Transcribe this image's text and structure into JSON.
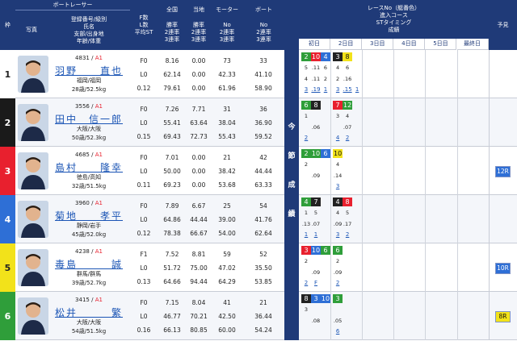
{
  "header": {
    "waku": "枠",
    "boat_racer": "ボートレーサー",
    "photo": "写真",
    "info_lines": [
      "登録番号/級別",
      "氏名",
      "支部/出身地",
      "年齢/体重"
    ],
    "f_lines": [
      "F数",
      "L数",
      "平均ST"
    ],
    "zenkoku": "全国",
    "touchi": "当地",
    "motor": "モーター",
    "boat": "ボート",
    "rate_lines": [
      "勝率",
      "2連率",
      "3連率"
    ],
    "no_lines": [
      "No",
      "2連率",
      "3連率"
    ],
    "race_lines": [
      "レースNo（艇番色）",
      "進入コース",
      "STタイミング",
      "成績"
    ],
    "days": [
      "初日",
      "2日目",
      "3日目",
      "4日目",
      "5日目",
      "最終日"
    ],
    "yosou": "予見",
    "konsetsu": [
      "今",
      "節",
      "成",
      "績"
    ]
  },
  "racers": [
    {
      "waku": "1",
      "reg": "4831",
      "cls": "A1",
      "name": "羽野　　直也",
      "region": "福岡/福岡",
      "agewt": "28歳/52.5kg",
      "f": [
        "F0",
        "L0",
        "0.12"
      ],
      "nat": [
        "8.16",
        "62.14",
        "79.61"
      ],
      "loc": [
        "0.00",
        "0.00",
        "0.00"
      ],
      "motor": [
        "73",
        "42.33",
        "61.96"
      ],
      "boat": [
        "33",
        "41.10",
        "58.90"
      ],
      "sessions": [
        {
          "c": [
            "2",
            "10",
            "4"
          ],
          "colors": [
            "#2f9e3a",
            "#e8202e",
            "#2e6fd6"
          ],
          "course": [
            "5",
            ".11",
            "6"
          ],
          "st": [
            "4",
            ".11",
            "2"
          ],
          "res": [
            "3",
            ".19",
            "1"
          ]
        },
        {
          "c": [
            "3",
            "8"
          ],
          "colors": [
            "#222",
            "#f2e21a"
          ],
          "course": [
            "4",
            "6"
          ],
          "st": [
            "2",
            ".16"
          ],
          "res": [
            "3",
            ".15",
            "1"
          ]
        }
      ],
      "prev": ""
    },
    {
      "waku": "2",
      "reg": "3556",
      "cls": "A1",
      "name": "田中　信一郎",
      "region": "大阪/大阪",
      "agewt": "50歳/52.3kg",
      "f": [
        "F0",
        "L0",
        "0.15"
      ],
      "nat": [
        "7.26",
        "55.41",
        "69.43"
      ],
      "loc": [
        "7.71",
        "63.64",
        "72.73"
      ],
      "motor": [
        "31",
        "38.04",
        "55.43"
      ],
      "boat": [
        "36",
        "36.90",
        "59.52"
      ],
      "sessions": [
        {
          "c": [
            "6",
            "8"
          ],
          "colors": [
            "#2f9e3a",
            "#222"
          ],
          "course": [
            "1",
            "",
            ""
          ],
          "st": [
            "",
            ".06",
            ""
          ],
          "res": [
            "2",
            "",
            ""
          ]
        },
        {
          "c": [
            "7",
            "12"
          ],
          "colors": [
            "#e8202e",
            "#2f9e3a"
          ],
          "course": [
            "3",
            "4"
          ],
          "st": [
            "",
            ".07"
          ],
          "res": [
            "4",
            "2"
          ]
        }
      ],
      "prev": ""
    },
    {
      "waku": "3",
      "reg": "4685",
      "cls": "A1",
      "name": "島村　　隆幸",
      "region": "徳島/高知",
      "agewt": "32歳/51.5kg",
      "f": [
        "F0",
        "L0",
        "0.11"
      ],
      "nat": [
        "7.01",
        "50.00",
        "69.23"
      ],
      "loc": [
        "0.00",
        "0.00",
        "0.00"
      ],
      "motor": [
        "21",
        "38.42",
        "53.68"
      ],
      "boat": [
        "42",
        "44.44",
        "63.33"
      ],
      "sessions": [
        {
          "c": [
            "2",
            "10",
            "6"
          ],
          "colors": [
            "#2f9e3a",
            "#2f9e3a",
            "#2e6fd6"
          ],
          "course": [
            "2",
            "",
            ""
          ],
          "st": [
            "",
            ".09",
            ""
          ],
          "res": [
            "",
            "",
            ""
          ]
        },
        {
          "c": [
            "10"
          ],
          "colors": [
            "#f2e21a"
          ],
          "course": [
            "4"
          ],
          "st": [
            ".14"
          ],
          "res": [
            "3"
          ]
        }
      ],
      "prev": "12R"
    },
    {
      "waku": "4",
      "reg": "3960",
      "cls": "A1",
      "name": "菊地　　孝平",
      "region": "静岡/岩手",
      "agewt": "45歳/52.0kg",
      "f": [
        "F0",
        "L0",
        "0.12"
      ],
      "nat": [
        "7.89",
        "64.86",
        "78.38"
      ],
      "loc": [
        "6.67",
        "44.44",
        "66.67"
      ],
      "motor": [
        "25",
        "39.00",
        "54.00"
      ],
      "boat": [
        "54",
        "41.76",
        "62.64"
      ],
      "sessions": [
        {
          "c": [
            "4",
            "7"
          ],
          "colors": [
            "#2f9e3a",
            "#222"
          ],
          "course": [
            "1",
            "5"
          ],
          "st": [
            ".13",
            ".07"
          ],
          "res": [
            "1",
            "1"
          ]
        },
        {
          "c": [
            "4",
            "8"
          ],
          "colors": [
            "#222",
            "#e8202e"
          ],
          "course": [
            "4",
            "5"
          ],
          "st": [
            ".09",
            ".17"
          ],
          "res": [
            "3",
            "2"
          ]
        }
      ],
      "prev": ""
    },
    {
      "waku": "5",
      "reg": "4238",
      "cls": "A1",
      "name": "毒島　　　誠",
      "region": "群馬/群馬",
      "agewt": "39歳/52.7kg",
      "f": [
        "F1",
        "L0",
        "0.13"
      ],
      "nat": [
        "7.52",
        "51.72",
        "64.66"
      ],
      "loc": [
        "8.81",
        "75.00",
        "94.44"
      ],
      "motor": [
        "59",
        "47.02",
        "64.29"
      ],
      "boat": [
        "52",
        "35.50",
        "53.85"
      ],
      "sessions": [
        {
          "c": [
            "3",
            "10",
            "6"
          ],
          "colors": [
            "#e8202e",
            "#2e6fd6",
            "#2f9e3a"
          ],
          "course": [
            "2",
            "",
            ""
          ],
          "st": [
            "",
            ".09",
            ""
          ],
          "res": [
            "2",
            "F",
            ""
          ]
        },
        {
          "c": [
            "6"
          ],
          "colors": [
            "#2f9e3a"
          ],
          "course": [
            "2"
          ],
          "st": [
            ".09"
          ],
          "res": [
            "2"
          ]
        }
      ],
      "prev": "10R"
    },
    {
      "waku": "6",
      "reg": "3415",
      "cls": "A1",
      "name": "松井　　　繁",
      "region": "大阪/大阪",
      "agewt": "54歳/51.5kg",
      "f": [
        "F0",
        "L0",
        "0.16"
      ],
      "nat": [
        "7.15",
        "46.77",
        "66.13"
      ],
      "loc": [
        "8.04",
        "70.21",
        "80.85"
      ],
      "motor": [
        "41",
        "42.50",
        "60.00"
      ],
      "boat": [
        "21",
        "36.44",
        "54.24"
      ],
      "sessions": [
        {
          "c": [
            "8",
            "3",
            "10"
          ],
          "colors": [
            "#222",
            "#2e6fd6",
            "#2e6fd6"
          ],
          "course": [
            "3",
            "",
            ""
          ],
          "st": [
            "",
            ".08",
            ""
          ],
          "res": [
            "",
            "",
            ""
          ]
        },
        {
          "c": [
            "3"
          ],
          "colors": [
            "#2f9e3a"
          ],
          "course": [
            "",
            ""
          ],
          "st": [
            ".05"
          ],
          "res": [
            "6"
          ]
        }
      ],
      "prev": "8R"
    }
  ],
  "colors": {
    "header": "#1f3a78",
    "highlight": "#e8202e",
    "waku": [
      "#ffffff",
      "#1a1a1a",
      "#e8202e",
      "#2e6fd6",
      "#f2e21a",
      "#2f9e3a"
    ]
  }
}
